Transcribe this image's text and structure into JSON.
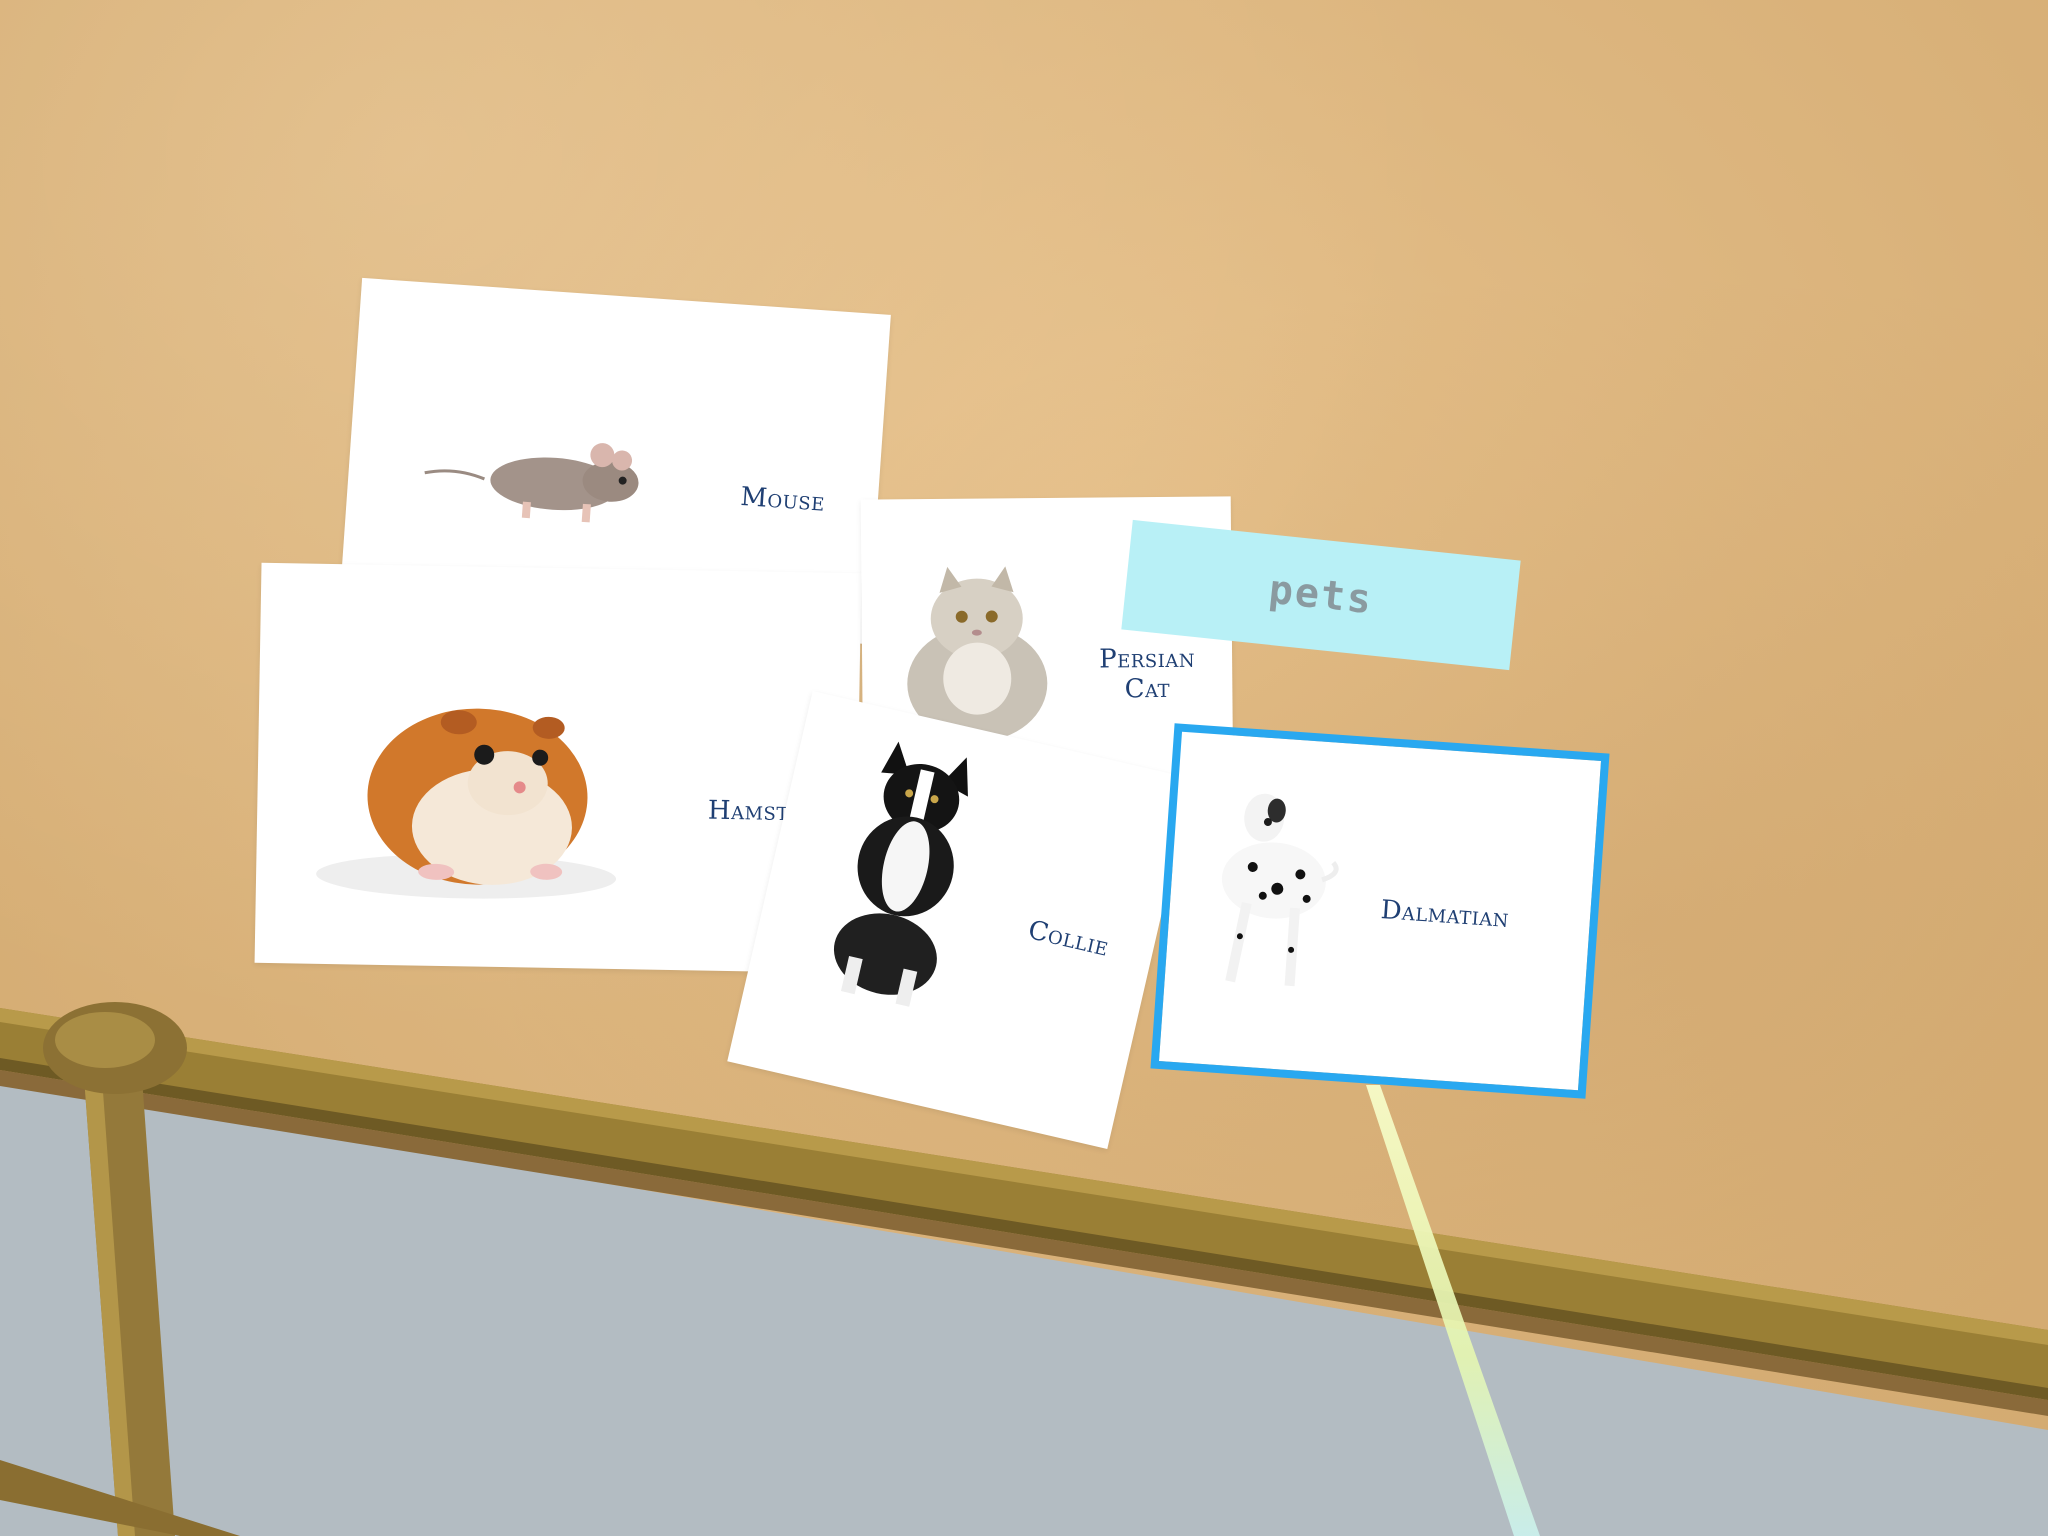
{
  "scene": {
    "category_tag": "pets",
    "cards": [
      {
        "id": "mouse",
        "label": "Mouse",
        "image_icon": "mouse-photo"
      },
      {
        "id": "hamster",
        "label": "Hamster",
        "image_icon": "hamster-photo"
      },
      {
        "id": "persian-cat",
        "label_line1": "Persian",
        "label_line2": "Cat",
        "image_icon": "persian-cat-photo"
      },
      {
        "id": "collie",
        "label": "Collie",
        "image_icon": "collie-photo"
      },
      {
        "id": "dalmatian",
        "label": "Dalmatian",
        "image_icon": "dalmatian-photo"
      }
    ]
  },
  "colors": {
    "wall": "#ddb67f",
    "rail": "#9a7f35",
    "floor": "#b3bcc2",
    "tag_background": "#b8f0f6",
    "selection_outline": "#29a8f0",
    "label_text": "#1f3f73",
    "pointer_ray": "#f2f8b0"
  }
}
